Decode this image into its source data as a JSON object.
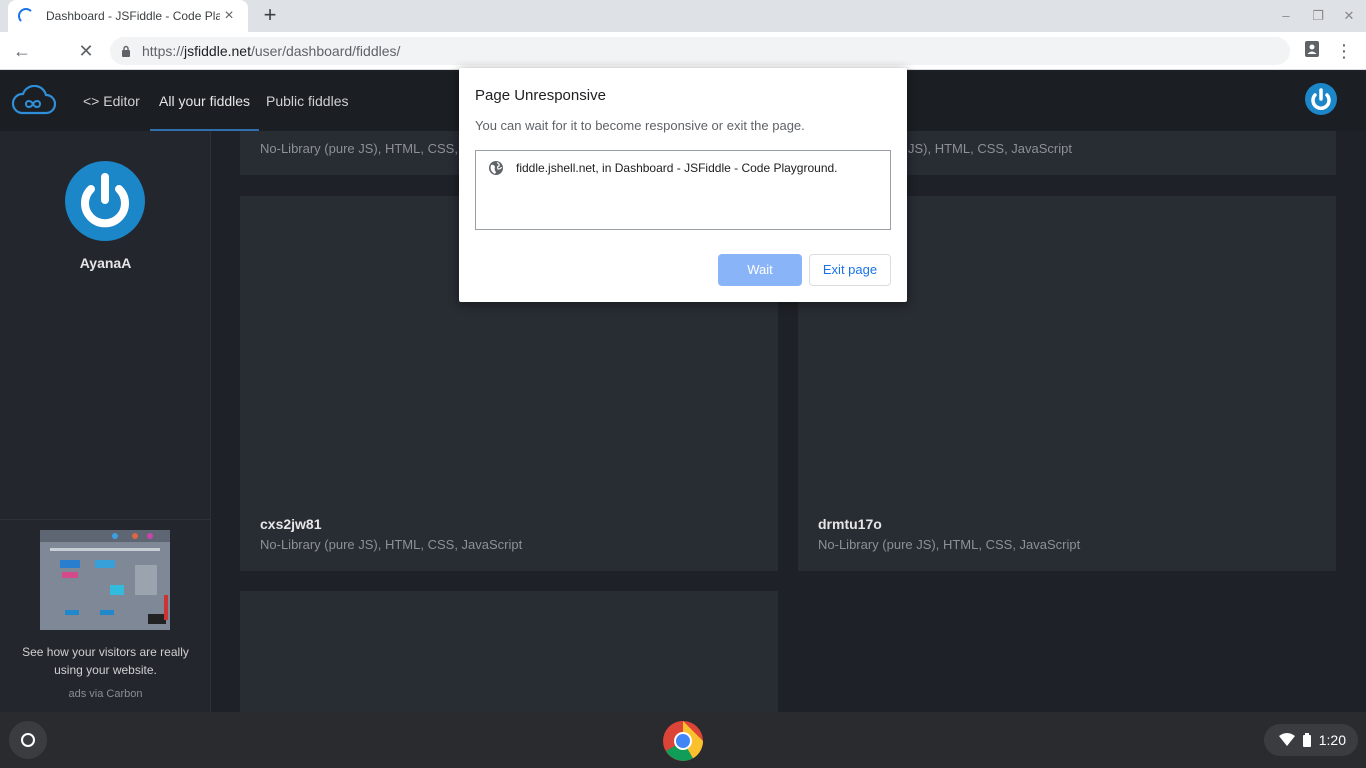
{
  "browser": {
    "tab_title": "Dashboard - JSFiddle - Code Playground",
    "url_host": "jsfiddle.net",
    "url_prefix": "https://",
    "url_path": "/user/dashboard/fiddles/"
  },
  "site": {
    "nav": {
      "editor": "Editor",
      "all": "All your fiddles",
      "public": "Public fiddles"
    },
    "colors": {
      "accent": "#2f6fad",
      "header_bg": "#1b1e23",
      "card_bg": "#282c33"
    }
  },
  "sidebar": {
    "username": "AyanaA",
    "ad_text": "See how your visitors are really using your website.",
    "ad_via": "ads via Carbon"
  },
  "cards": [
    {
      "title": "cxs2jw81",
      "meta": "No-Library (pure JS), HTML, CSS, JavaScript"
    },
    {
      "title": "drmtu17o",
      "meta": "No-Library (pure JS), HTML, CSS, JavaScript"
    }
  ],
  "top_cards": [
    {
      "meta": "No-Library (pure JS), HTML, CSS, Ja"
    },
    {
      "meta": "JS), HTML, CSS, JavaScript"
    }
  ],
  "dialog": {
    "title": "Page Unresponsive",
    "message": "You can wait for it to become responsive or exit the page.",
    "entry": "fiddle.jshell.net, in Dashboard - JSFiddle - Code Playground.",
    "wait_label": "Wait",
    "exit_label": "Exit page"
  },
  "shelf": {
    "time": "1:20"
  }
}
